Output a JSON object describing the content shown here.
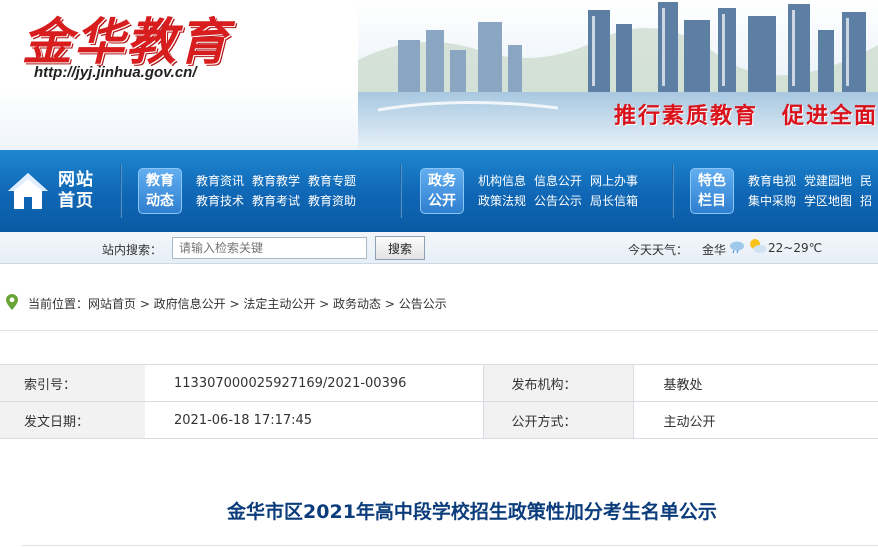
{
  "banner": {
    "logo_text": "金华教育",
    "url": "http://jyj.jinhua.gov.cn/",
    "slogan_part1": "推行素质教育",
    "slogan_part2": "促进全面"
  },
  "nav": {
    "home_label_line1": "网站",
    "home_label_line2": "首页",
    "groups": [
      {
        "tag_line1": "教育",
        "tag_line2": "动态",
        "links": [
          "教育资讯",
          "教育教学",
          "教育专题",
          "教育技术",
          "教育考试",
          "教育资助"
        ]
      },
      {
        "tag_line1": "政务",
        "tag_line2": "公开",
        "links": [
          "机构信息",
          "信息公开",
          "网上办事",
          "政策法规",
          "公告公示",
          "局长信箱"
        ]
      },
      {
        "tag_line1": "特色",
        "tag_line2": "栏目",
        "links": [
          "教育电视",
          "党建园地",
          "民",
          "集中采购",
          "学区地图",
          "招"
        ]
      }
    ]
  },
  "search": {
    "label": "站内搜索：",
    "placeholder": "请输入检索关键",
    "button_label": "搜索"
  },
  "weather": {
    "label": "今天天气：",
    "city": "金华",
    "temp": "22~29℃"
  },
  "breadcrumb": {
    "text": "当前位置：网站首页 > 政府信息公开 > 法定主动公开 > 政务动态 > 公告公示"
  },
  "info": {
    "index_label": "索引号：",
    "index_value": "113307000025927169/2021-00396",
    "org_label": "发布机构：",
    "org_value": "基教处",
    "date_label": "发文日期：",
    "date_value": "2021-06-18 17:17:45",
    "method_label": "公开方式：",
    "method_value": "主动公开"
  },
  "document": {
    "title": "金华市区2021年高中段学校招生政策性加分考生名单公示"
  },
  "colors": {
    "nav_blue": "#0f66b4",
    "logo_red": "#d71d1d",
    "title_blue": "#0b3c7c"
  }
}
